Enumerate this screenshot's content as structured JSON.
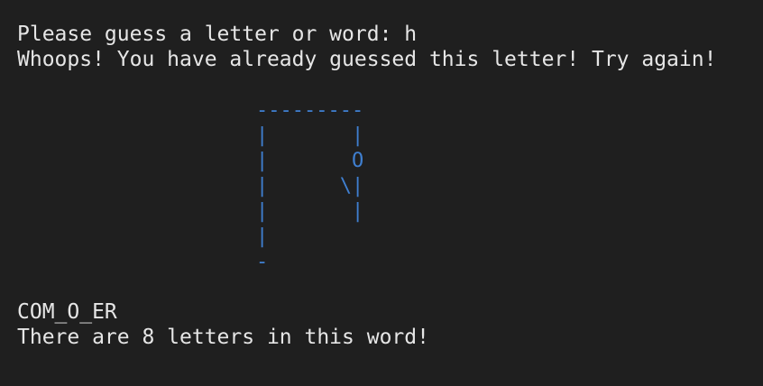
{
  "terminal": {
    "prompt_line": "Please guess a letter or word: h",
    "message_line": "Whoops! You have already guessed this letter! Try again!",
    "hangman_art": "---------\n|       |\n|       O\n|      \\|\n|       |\n|\n-",
    "word_progress": "COM_O_ER",
    "info_line": "There are 8 letters in this word!"
  },
  "colors": {
    "background": "#1f1f1f",
    "text": "#e6e6e6",
    "art": "#3f7fd0"
  }
}
